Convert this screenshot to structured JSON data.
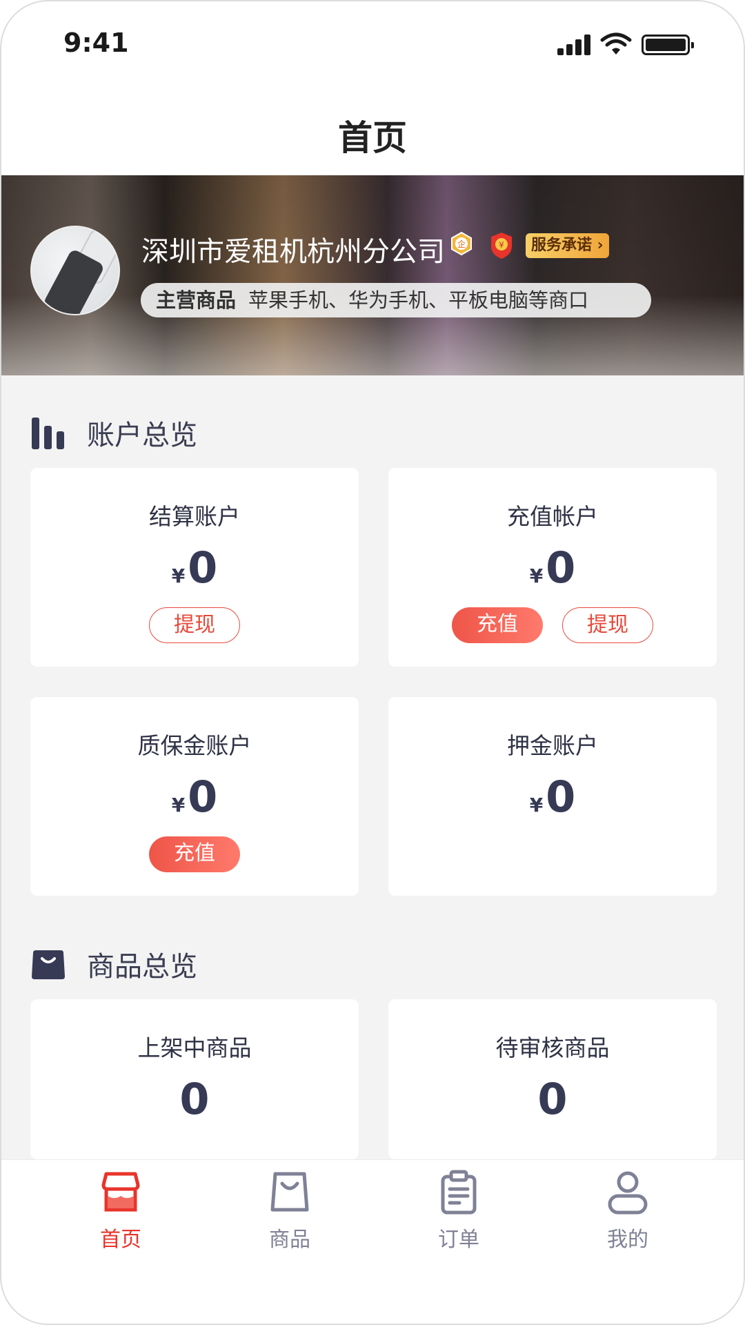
{
  "status_bar": {
    "time": "9:41"
  },
  "header": {
    "title": "首页"
  },
  "shop": {
    "name": "深圳市爱租机杭州分公司",
    "promise_label": "服务承诺",
    "main_goods_label": "主营商品",
    "main_goods_value": "苹果手机、华为手机、平板电脑等商口"
  },
  "account_overview": {
    "title": "账户总览",
    "currency": "¥",
    "cards": [
      {
        "label": "结算账户",
        "amount": "0",
        "buttons": [
          "提现"
        ]
      },
      {
        "label": "充值帐户",
        "amount": "0",
        "buttons": [
          "充值",
          "提现"
        ]
      },
      {
        "label": "质保金账户",
        "amount": "0",
        "buttons": [
          "充值"
        ]
      },
      {
        "label": "押金账户",
        "amount": "0",
        "buttons": []
      }
    ]
  },
  "goods_overview": {
    "title": "商品总览",
    "cards": [
      {
        "label": "上架中商品",
        "count": "0"
      },
      {
        "label": "待审核商品",
        "count": "0"
      }
    ]
  },
  "tabbar": {
    "active": "首页",
    "items": [
      {
        "label": "首页",
        "icon": "shop-icon"
      },
      {
        "label": "商品",
        "icon": "bag-icon"
      },
      {
        "label": "订单",
        "icon": "clipboard-icon"
      },
      {
        "label": "我的",
        "icon": "user-icon"
      }
    ]
  },
  "colors": {
    "accent": "#e8342b",
    "text_dark": "#3a3d52",
    "promise_gold": "#f0a53a"
  }
}
